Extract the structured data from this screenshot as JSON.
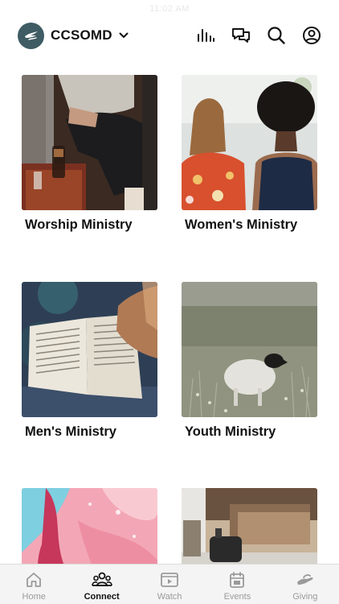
{
  "status": {
    "time": "11:02 AM"
  },
  "header": {
    "org_name": "CCSOMD",
    "icons": [
      "analytics-icon",
      "messages-icon",
      "search-icon",
      "profile-icon"
    ]
  },
  "ministries": [
    {
      "title": "Worship Ministry",
      "image": "guitarist-seated-photo"
    },
    {
      "title": "Women's Ministry",
      "image": "two-women-outdoors-photo"
    },
    {
      "title": "Men's Ministry",
      "image": "open-bible-photo"
    },
    {
      "title": "Youth Ministry",
      "image": "lamb-in-meadow-photo"
    },
    {
      "title": "",
      "image": "pink-blue-paint-photo"
    },
    {
      "title": "",
      "image": "coffee-kettle-photo"
    }
  ],
  "tabbar": {
    "tabs": [
      {
        "label": "Home",
        "icon": "home-icon",
        "active": false
      },
      {
        "label": "Connect",
        "icon": "people-icon",
        "active": true
      },
      {
        "label": "Watch",
        "icon": "play-icon",
        "active": false
      },
      {
        "label": "Events",
        "icon": "calendar-icon",
        "active": false
      },
      {
        "label": "Giving",
        "icon": "hand-icon",
        "active": false
      }
    ]
  },
  "colors": {
    "logo_bg": "#3f5b63",
    "active_tab": "#111111",
    "inactive_tab": "#9a9a9a",
    "tabbar_bg": "#f4f4f4"
  }
}
